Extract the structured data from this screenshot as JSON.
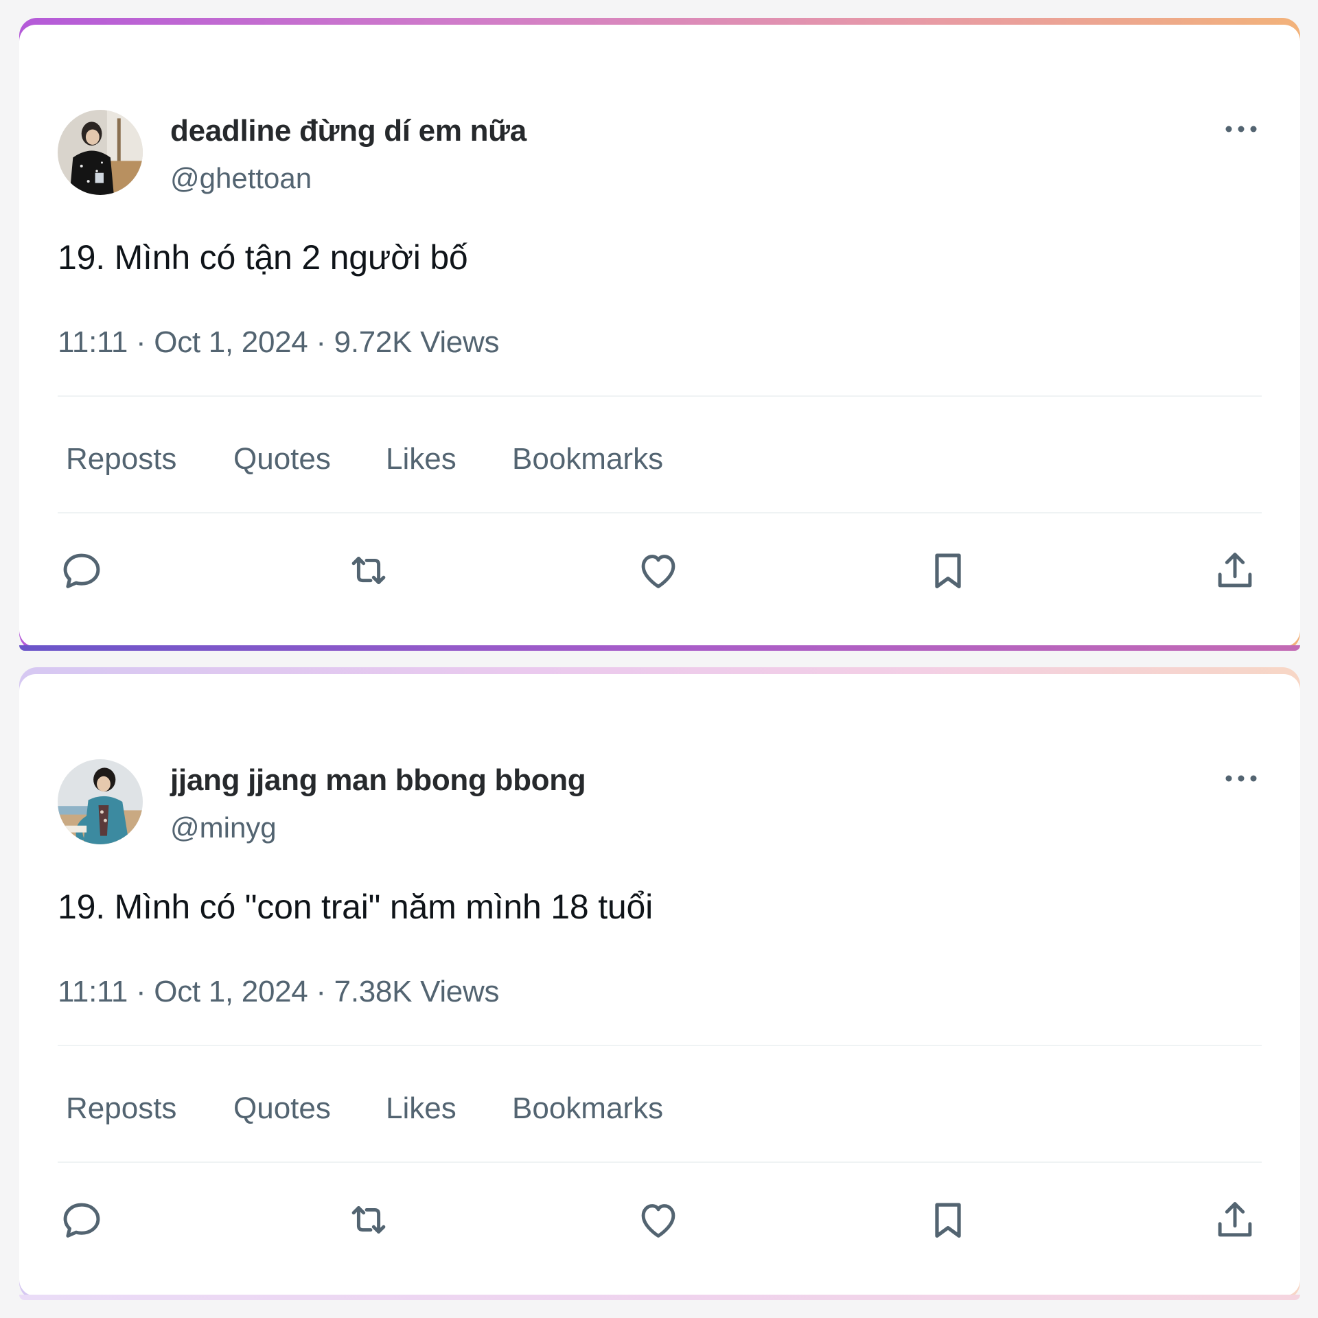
{
  "posts": [
    {
      "display_name": "deadline đừng dí em nữa",
      "handle": "@ghettoan",
      "text": "19. Mình có tận 2 người bố",
      "meta": "11:11 · Oct 1, 2024 · 9.72K Views",
      "stats": [
        "Reposts",
        "Quotes",
        "Likes",
        "Bookmarks"
      ]
    },
    {
      "display_name": "jjang jjang man bbong bbong",
      "handle": "@minyg",
      "text": "19. Mình có \"con trai\" năm mình 18 tuổi",
      "meta": "11:11 · Oct 1, 2024 · 7.38K Views",
      "stats": [
        "Reposts",
        "Quotes",
        "Likes",
        "Bookmarks"
      ]
    }
  ],
  "icons": {
    "more": "more-horizontal-icon",
    "reply": "speech-bubble-icon",
    "repost": "repost-arrows-icon",
    "like": "heart-icon",
    "bookmark": "bookmark-icon",
    "share": "share-upload-icon"
  },
  "colors": {
    "text_primary": "#0f1419",
    "text_secondary": "#536471",
    "divider": "#eff3f4"
  }
}
